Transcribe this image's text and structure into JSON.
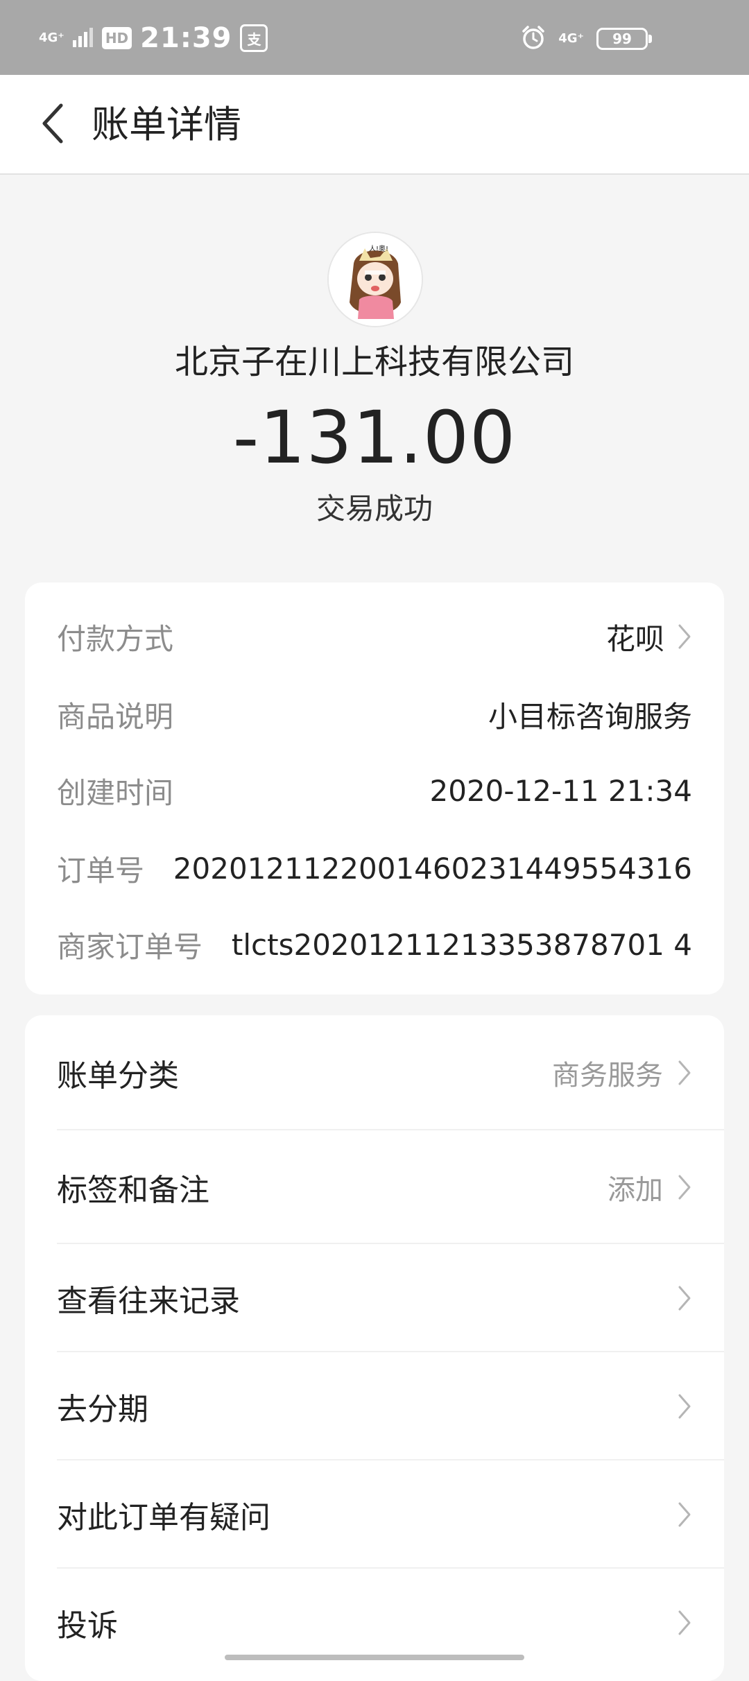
{
  "status_bar": {
    "network_left": "4G⁺",
    "hd": "HD",
    "time": "21:39",
    "app_badge": "支",
    "network_right": "4G⁺",
    "battery": "99"
  },
  "nav": {
    "title": "账单详情"
  },
  "transaction": {
    "merchant": "北京子在川上科技有限公司",
    "amount": "-131.00",
    "status": "交易成功"
  },
  "details": [
    {
      "label": "付款方式",
      "value": "花呗"
    },
    {
      "label": "商品说明",
      "value": "小目标咨询服务"
    },
    {
      "label": "创建时间",
      "value": "2020-12-11 21:34"
    },
    {
      "label": "订单号",
      "value": "2020121122001460231449554316"
    },
    {
      "label": "商家订单号",
      "value": "tlcts20201211213353878701 4"
    }
  ],
  "actions": [
    {
      "label": "账单分类",
      "value": "商务服务"
    },
    {
      "label": "标签和备注",
      "value": "添加"
    },
    {
      "label": "查看往来记录",
      "value": ""
    },
    {
      "label": "去分期",
      "value": ""
    },
    {
      "label": "对此订单有疑问",
      "value": ""
    },
    {
      "label": "投诉",
      "value": ""
    }
  ],
  "colors": {
    "status_bar_bg": "#a8a8a8",
    "page_bg": "#f5f5f5",
    "card_bg": "#ffffff",
    "label_gray": "#8c8c8c",
    "text_dark": "#222222"
  },
  "icons": {
    "back": "back-arrow-icon",
    "chevron": "chevron-right-icon"
  }
}
